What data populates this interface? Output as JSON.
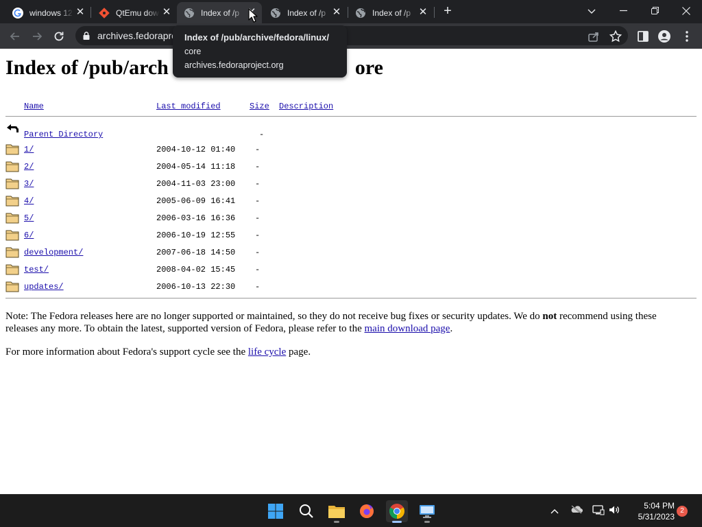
{
  "tabs": [
    {
      "title": "windows 12",
      "icon": "google-g-icon"
    },
    {
      "title": "QtEmu dow",
      "icon": "git-icon"
    },
    {
      "title": "Index of /p",
      "icon": "globe-icon",
      "active": true
    },
    {
      "title": "Index of /p",
      "icon": "globe-icon"
    },
    {
      "title": "Index of /p",
      "icon": "globe-icon"
    }
  ],
  "address_bar": {
    "url": "archives.fedoraproject.org"
  },
  "tooltip": {
    "title_line1": "Index of /pub/archive/fedora/linux/",
    "title_line2": "core",
    "host": "archives.fedoraproject.org"
  },
  "page": {
    "heading_left": "Index of /pub/arch",
    "heading_right": "ore",
    "columns": {
      "name": "Name",
      "modified": "Last modified",
      "size": "Size",
      "description": "Description"
    },
    "parent": {
      "name": "Parent Directory",
      "size": "-"
    },
    "rows": [
      {
        "name": "1/",
        "modified": "2004-10-12 01:40",
        "size": "-"
      },
      {
        "name": "2/",
        "modified": "2004-05-14 11:18",
        "size": "-"
      },
      {
        "name": "3/",
        "modified": "2004-11-03 23:00",
        "size": "-"
      },
      {
        "name": "4/",
        "modified": "2005-06-09 16:41",
        "size": "-"
      },
      {
        "name": "5/",
        "modified": "2006-03-16 16:36",
        "size": "-"
      },
      {
        "name": "6/",
        "modified": "2006-10-19 12:55",
        "size": "-"
      },
      {
        "name": "development/",
        "modified": "2007-06-18 14:50",
        "size": "-"
      },
      {
        "name": "test/",
        "modified": "2008-04-02 15:45",
        "size": "-"
      },
      {
        "name": "updates/",
        "modified": "2006-10-13 22:30",
        "size": "-"
      }
    ],
    "note": {
      "part1": "Note: The Fedora releases here are no longer supported or maintained, so they do not receive bug fixes or security updates. We do ",
      "bold": "not",
      "part2": " recommend using these releases any more. To obtain the latest, supported version of Fedora, please refer to the ",
      "link": "main download page",
      "part3": "."
    },
    "info": {
      "part1": "For more information about Fedora's support cycle see the ",
      "link": "life cycle",
      "part2": " page."
    }
  },
  "taskbar": {
    "time": "5:04 PM",
    "date": "5/31/2023",
    "notification_count": "2"
  }
}
